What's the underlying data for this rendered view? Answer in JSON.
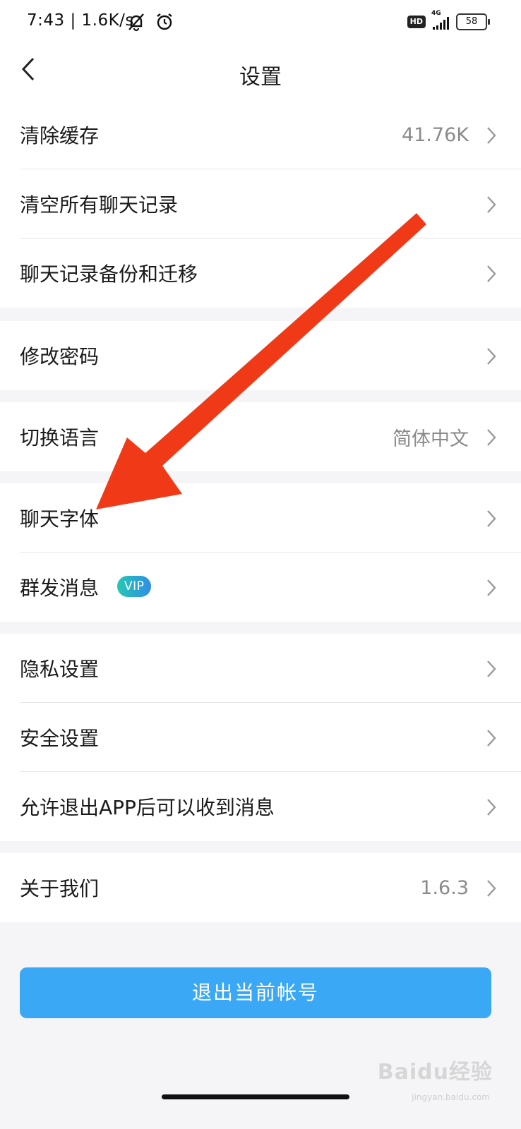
{
  "status_bar": {
    "time": "7:43 | 1.6K/s",
    "network": "4G",
    "hd": "HD",
    "battery": "58"
  },
  "header": {
    "title": "设置"
  },
  "groups": [
    {
      "items": [
        {
          "label": "清除缓存",
          "value": "41.76K"
        },
        {
          "label": "清空所有聊天记录",
          "value": ""
        },
        {
          "label": "聊天记录备份和迁移",
          "value": ""
        }
      ]
    },
    {
      "items": [
        {
          "label": "修改密码",
          "value": ""
        }
      ]
    },
    {
      "items": [
        {
          "label": "切换语言",
          "value": "简体中文"
        }
      ]
    },
    {
      "items": [
        {
          "label": "聊天字体",
          "value": ""
        },
        {
          "label": "群发消息",
          "value": "",
          "badge": "VIP"
        }
      ]
    },
    {
      "items": [
        {
          "label": "隐私设置",
          "value": ""
        },
        {
          "label": "安全设置",
          "value": ""
        },
        {
          "label": "允许退出APP后可以收到消息",
          "value": ""
        }
      ]
    },
    {
      "items": [
        {
          "label": "关于我们",
          "value": "1.6.3"
        }
      ]
    }
  ],
  "logout_label": "退出当前帐号",
  "watermark": {
    "text": "Baidu经验",
    "sub": "jingyan.baidu.com"
  },
  "colors": {
    "accent": "#3aa8f5",
    "annotation_arrow": "#f03a17",
    "background": "#f5f5f7"
  }
}
